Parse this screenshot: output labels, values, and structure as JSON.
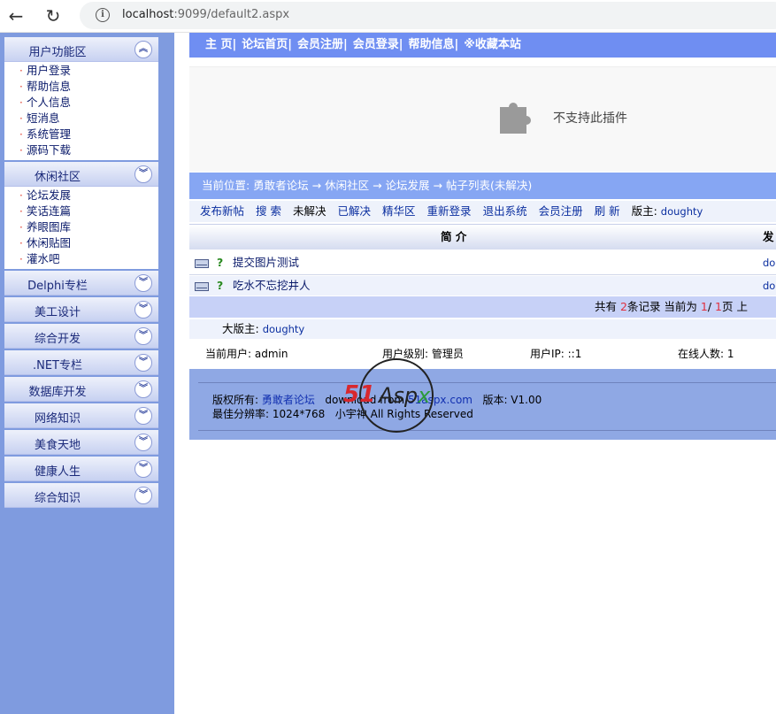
{
  "browser": {
    "url_host": "localhost",
    "url_rest": ":9099/default2.aspx"
  },
  "sidebar": {
    "panels": [
      {
        "title": "用户功能区",
        "toggle": "︽",
        "items": [
          "用户登录",
          "帮助信息",
          "个人信息",
          "短消息",
          "系统管理",
          "源码下载"
        ]
      },
      {
        "title": "休闲社区",
        "toggle": "︾",
        "items": [
          "论坛发展",
          "笑话连篇",
          "养眼图库",
          "休闲贴图",
          "灌水吧"
        ]
      },
      {
        "title": "Delphi专栏",
        "toggle": "︾"
      },
      {
        "title": "美工设计",
        "toggle": "︾"
      },
      {
        "title": "综合开发",
        "toggle": "︾"
      },
      {
        "title": ".NET专栏",
        "toggle": "︾"
      },
      {
        "title": "数据库开发",
        "toggle": "︾"
      },
      {
        "title": "网络知识",
        "toggle": "︾"
      },
      {
        "title": "美食天地",
        "toggle": "︾"
      },
      {
        "title": "健康人生",
        "toggle": "︾"
      },
      {
        "title": "综合知识",
        "toggle": "︾"
      }
    ]
  },
  "topnav": [
    "主 页|",
    "论坛首页|",
    "会员注册|",
    "会员登录|",
    "帮助信息|",
    "※收藏本站"
  ],
  "plugin": {
    "message": "不支持此插件"
  },
  "location": "当前位置: 勇敢者论坛 → 休闲社区 → 论坛发展 → 帖子列表(未解决)",
  "toolbar": {
    "items": [
      "发布新帖",
      "搜 索",
      "未解决",
      "已解决",
      "精华区",
      "重新登录",
      "退出系统",
      "会员注册",
      "刷 新"
    ],
    "moderator_label": "版主:",
    "moderator": "doughty"
  },
  "table": {
    "headers": [
      "简 介",
      "发"
    ],
    "rows": [
      {
        "icon": "?",
        "title": "提交图片测试",
        "user": "do"
      },
      {
        "icon": "?",
        "title": "吃水不忘挖井人",
        "user": "do"
      }
    ]
  },
  "pager": {
    "pre": "共有 ",
    "count": "2",
    "post": "条记录   当前为 ",
    "current": "1",
    "slash": "/ ",
    "total": "1",
    "end": "页 上"
  },
  "boss": {
    "label": "大版主:",
    "name": "doughty"
  },
  "status": {
    "user": "当前用户: admin",
    "level": "用户级别: 管理员",
    "ip": "用户IP: ::1",
    "online": "在线人数: 1"
  },
  "footer": {
    "copyright_label": "版权所有:",
    "site": "勇敢者论坛",
    "download": "download from ",
    "download_site": "51aspx.com",
    "version": "版本: V1.00",
    "resolution": "最佳分辨率: 1024*768",
    "rights": "All Rights Reserved",
    "rights_prefix": "小宇神"
  },
  "logo": {
    "text_51": "51",
    "text_asp": "Asp",
    "text_x": "x"
  }
}
